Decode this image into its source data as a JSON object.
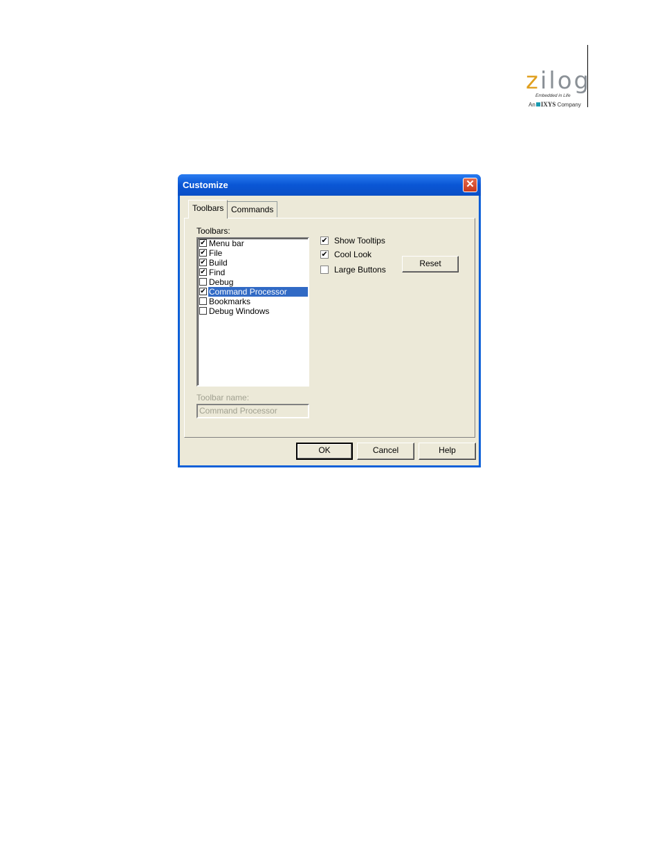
{
  "logo": {
    "letter_z": "z",
    "rest": "ilog",
    "tagline": "Embedded in Life",
    "company_prefix": "An",
    "company_name": "IXYS",
    "company_suffix": "Company"
  },
  "dialog": {
    "title": "Customize",
    "close_glyph": "✕",
    "tabs": [
      {
        "label": "Toolbars",
        "active": true
      },
      {
        "label": "Commands",
        "active": false
      }
    ],
    "toolbars_label": "Toolbars:",
    "toolbars": [
      {
        "label": "Menu bar",
        "checked": true,
        "selected": false
      },
      {
        "label": "File",
        "checked": true,
        "selected": false
      },
      {
        "label": "Build",
        "checked": true,
        "selected": false
      },
      {
        "label": "Find",
        "checked": true,
        "selected": false
      },
      {
        "label": "Debug",
        "checked": false,
        "selected": false
      },
      {
        "label": "Command Processor",
        "checked": true,
        "selected": true
      },
      {
        "label": "Bookmarks",
        "checked": false,
        "selected": false
      },
      {
        "label": "Debug Windows",
        "checked": false,
        "selected": false
      }
    ],
    "options": [
      {
        "label": "Show Tooltips",
        "checked": true
      },
      {
        "label": "Cool Look",
        "checked": true
      },
      {
        "label": "Large Buttons",
        "checked": false
      }
    ],
    "reset_label": "Reset",
    "toolbar_name_label": "Toolbar name:",
    "toolbar_name_value": "Command Processor",
    "ok_label": "OK",
    "cancel_label": "Cancel",
    "help_label": "Help"
  },
  "colors": {
    "title_bar": "#0a56d5",
    "selection": "#316ac5",
    "face": "#ece9d8",
    "logo_accent": "#e0a020"
  }
}
